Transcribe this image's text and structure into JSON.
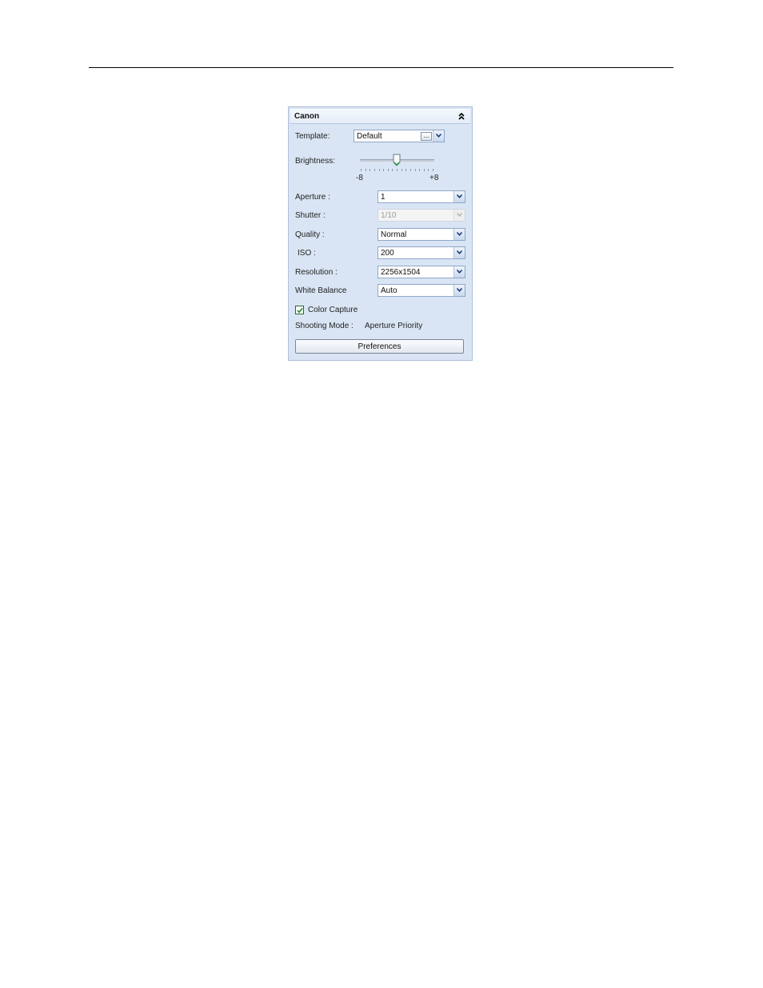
{
  "panel": {
    "title": "Canon",
    "collapse_icon": "double-chevron-up-icon"
  },
  "template": {
    "label": "Template:",
    "value": "Default",
    "browse_label": "...",
    "dropdown_icon": "chevron-down-icon"
  },
  "brightness": {
    "label": "Brightness:",
    "min_label": "-8",
    "max_label": "+8",
    "min": -8,
    "max": 8,
    "value": 0
  },
  "fields": [
    {
      "label": "Aperture :",
      "value": "1",
      "enabled": true
    },
    {
      "label": "Shutter :",
      "value": "1/10",
      "enabled": false
    },
    {
      "label": "Quality :",
      "value": "Normal",
      "enabled": true
    },
    {
      "label": "ISO :",
      "value": "200",
      "enabled": true
    },
    {
      "label": "Resolution :",
      "value": "2256x1504",
      "enabled": true
    },
    {
      "label": "White Balance",
      "value": "Auto",
      "enabled": true
    }
  ],
  "color_capture": {
    "label": "Color Capture",
    "checked": true
  },
  "shooting_mode": {
    "label": "Shooting Mode :",
    "value": "Aperture Priority"
  },
  "preferences_button": {
    "label": "Preferences"
  },
  "colors": {
    "panel_bg": "#d9e5f4",
    "panel_border": "#aebfd7",
    "check_green": "#1f8a2f"
  }
}
